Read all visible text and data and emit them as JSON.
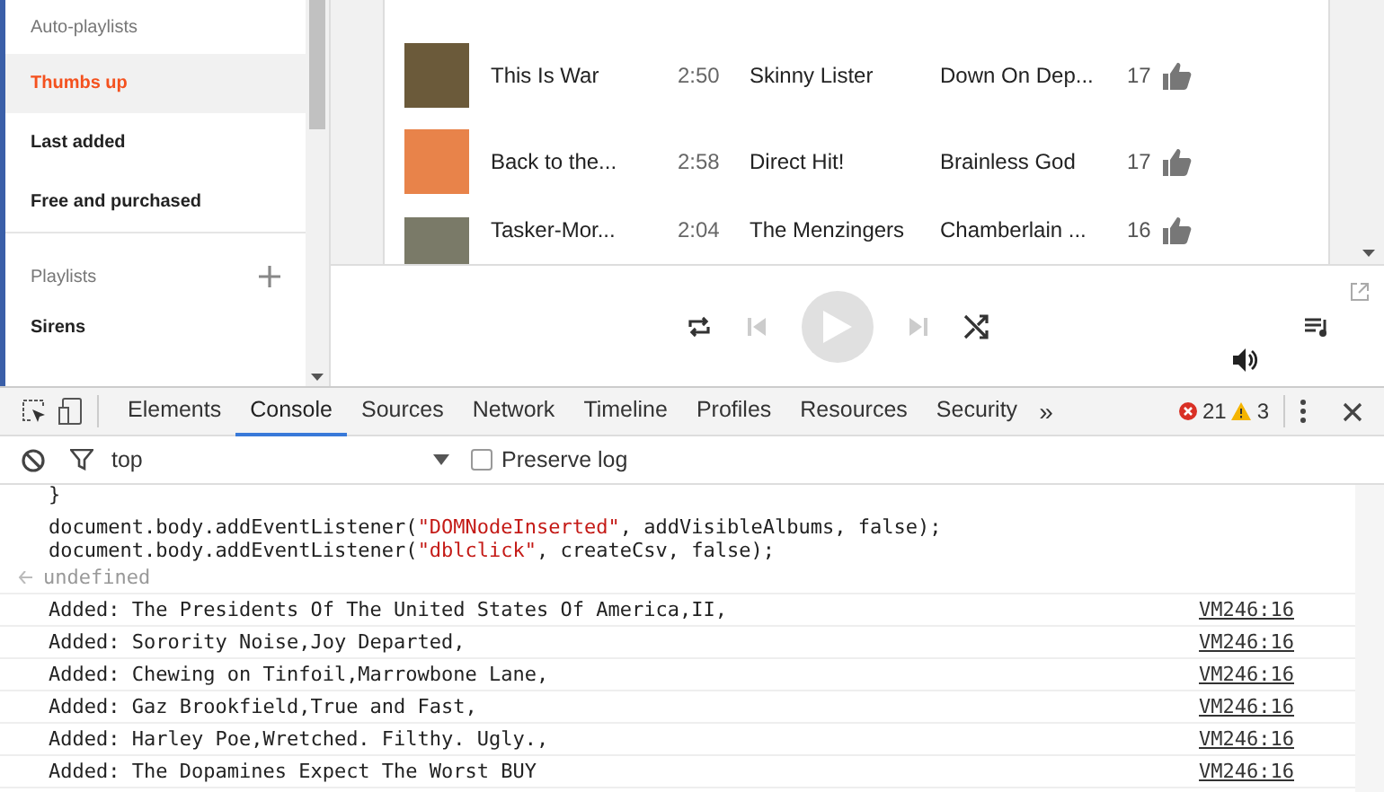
{
  "sidebar": {
    "sections": [
      {
        "title": "Auto-playlists",
        "addable": false,
        "items": [
          {
            "label": "Thumbs up",
            "selected": true
          },
          {
            "label": "Last added",
            "selected": false
          },
          {
            "label": "Free and purchased",
            "selected": false
          }
        ]
      },
      {
        "title": "Playlists",
        "addable": true,
        "items": [
          {
            "label": "Sirens",
            "selected": false
          }
        ]
      }
    ]
  },
  "tracks": [
    {
      "title": "This Is War",
      "duration": "2:50",
      "artist": "Skinny Lister",
      "album": "Down On Dep...",
      "plays": "17",
      "color": "#6b5a3a"
    },
    {
      "title": "Back to the...",
      "duration": "2:58",
      "artist": "Direct Hit!",
      "album": "Brainless God",
      "plays": "17",
      "color": "#e8834a"
    },
    {
      "title": "Tasker-Mor...",
      "duration": "2:04",
      "artist": "The Menzingers",
      "album": "Chamberlain ...",
      "plays": "16",
      "color": "#7a7a68"
    }
  ],
  "player": {
    "playing": false
  },
  "devtools": {
    "tabs": [
      {
        "label": "Elements",
        "selected": false
      },
      {
        "label": "Console",
        "selected": true
      },
      {
        "label": "Sources",
        "selected": false
      },
      {
        "label": "Network",
        "selected": false
      },
      {
        "label": "Timeline",
        "selected": false
      },
      {
        "label": "Profiles",
        "selected": false
      },
      {
        "label": "Resources",
        "selected": false
      },
      {
        "label": "Security",
        "selected": false
      }
    ],
    "more": "»",
    "errors": "21",
    "warnings": "3",
    "context": "top",
    "preserve_log": {
      "label": "Preserve log",
      "checked": false
    },
    "console": [
      {
        "kind": "code",
        "parts": [
          {
            "kind": "plain",
            "text": "}"
          }
        ]
      },
      {
        "kind": "blank"
      },
      {
        "kind": "code",
        "parts": [
          {
            "kind": "plain",
            "text": "document.body.addEventListener("
          },
          {
            "kind": "string",
            "text": "\"DOMNodeInserted\""
          },
          {
            "kind": "plain",
            "text": ", addVisibleAlbums, false);"
          }
        ]
      },
      {
        "kind": "code",
        "parts": [
          {
            "kind": "plain",
            "text": "document.body.addEventListener("
          },
          {
            "kind": "string",
            "text": "\"dblclick\""
          },
          {
            "kind": "plain",
            "text": ", createCsv, false);"
          }
        ]
      },
      {
        "kind": "result",
        "text": "undefined"
      },
      {
        "kind": "log",
        "text": "Added: The Presidents Of The United States Of America,II,",
        "source": "VM246:16"
      },
      {
        "kind": "log",
        "text": "Added: Sorority Noise,Joy Departed,",
        "source": "VM246:16"
      },
      {
        "kind": "log",
        "text": "Added: Chewing on Tinfoil,Marrowbone Lane,",
        "source": "VM246:16"
      },
      {
        "kind": "log",
        "text": "Added: Gaz Brookfield,True and Fast,",
        "source": "VM246:16"
      },
      {
        "kind": "log",
        "text": "Added: Harley Poe,Wretched. Filthy. Ugly.,",
        "source": "VM246:16"
      },
      {
        "kind": "log",
        "text": "Added: The Dopamines Expect The Worst BUY",
        "source": "VM246:16"
      }
    ]
  }
}
